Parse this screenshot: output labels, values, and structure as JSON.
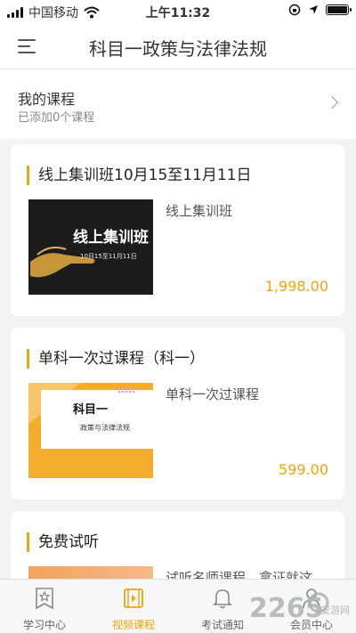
{
  "status_bar": {
    "carrier": "中国移动",
    "time": "上午11:32"
  },
  "nav": {
    "title": "科目一政策与法律法规"
  },
  "my_courses": {
    "title": "我的课程",
    "subtitle": "已添加0个课程"
  },
  "cards": [
    {
      "title": "线上集训班10月15至11月11日",
      "course_name": "线上集训班",
      "price": "1,998.00",
      "thumb_text": "线上集训班",
      "thumb_sub": "10月15至11月11日"
    },
    {
      "title": "单科一次过课程（科一）",
      "course_name": "单科一次过课程",
      "price": "599.00",
      "thumb_text": "科目一",
      "thumb_sub": "政策与法律法规"
    },
    {
      "title": "免费试听",
      "course_name": "试听名师课程，拿证就这"
    }
  ],
  "tabs": [
    {
      "label": "学习中心",
      "icon": "star-doc-icon"
    },
    {
      "label": "视频课程",
      "icon": "video-icon",
      "active": true
    },
    {
      "label": "考试通知",
      "icon": "bell-icon"
    },
    {
      "label": "会员中心",
      "icon": "user-icon"
    }
  ],
  "watermark": {
    "text": "2265",
    "sub": "安游网"
  },
  "colors": {
    "accent": "#f0a30a",
    "background": "#f2f2f2"
  }
}
